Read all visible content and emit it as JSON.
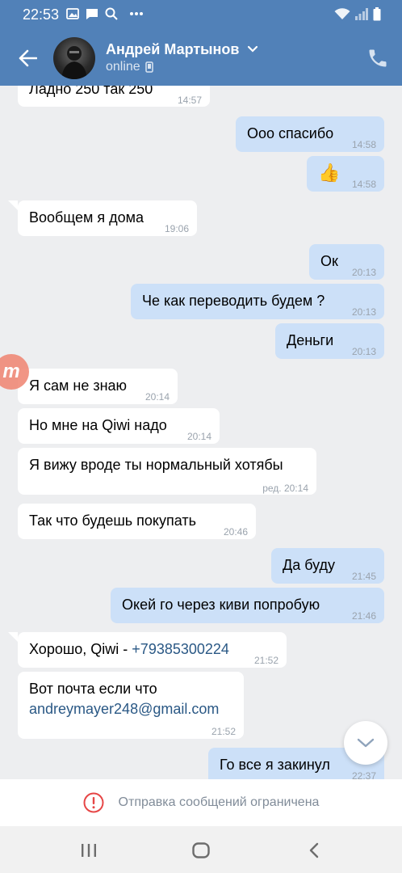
{
  "status_bar": {
    "time": "22:53",
    "icons_left": [
      "image-icon",
      "message-icon",
      "search-icon",
      "more-icon"
    ],
    "icons_right": [
      "wifi-icon",
      "signal-icon",
      "battery-icon"
    ]
  },
  "header": {
    "contact_name": "Андрей Мартынов",
    "status": "online",
    "accent_color": "#5181b8"
  },
  "messages": [
    {
      "dir": "in",
      "text": "Ладно 250 так 250",
      "time": "14:57"
    },
    {
      "dir": "out",
      "text": "Ооо спасибо",
      "time": "14:58"
    },
    {
      "dir": "out",
      "text": "👍",
      "time": "14:58"
    },
    {
      "dir": "in",
      "text": "Вообщем я дома",
      "time": "19:06"
    },
    {
      "dir": "out",
      "text": "Ок",
      "time": "20:13"
    },
    {
      "dir": "out",
      "text": "Че как переводить будем ?",
      "time": "20:13"
    },
    {
      "dir": "out",
      "text": "Деньги",
      "time": "20:13"
    },
    {
      "dir": "in",
      "text": "Я сам не знаю",
      "time": "20:14"
    },
    {
      "dir": "in",
      "text": "Но мне на Qiwi надо",
      "time": "20:14"
    },
    {
      "dir": "in",
      "text": "Я вижу вроде ты нормальный хотябы",
      "time": "ред. 20:14"
    },
    {
      "dir": "in",
      "text": "Так что будешь покупать",
      "time": "20:46"
    },
    {
      "dir": "out",
      "text": "Да буду",
      "time": "21:45"
    },
    {
      "dir": "out",
      "text": "Окей го через киви попробую",
      "time": "21:46"
    },
    {
      "dir": "in",
      "text_prefix": "Хорошо, Qiwi - ",
      "link": "+79385300224",
      "time": "21:52"
    },
    {
      "dir": "in",
      "text": "Вот почта если что",
      "link": "andreymayer248@gmail.com",
      "time": "21:52"
    },
    {
      "dir": "out",
      "text": "Го все я закинул",
      "time": "22:37"
    }
  ],
  "restriction_notice": "Отправка сообщений ограничена",
  "badge_letter": "m"
}
